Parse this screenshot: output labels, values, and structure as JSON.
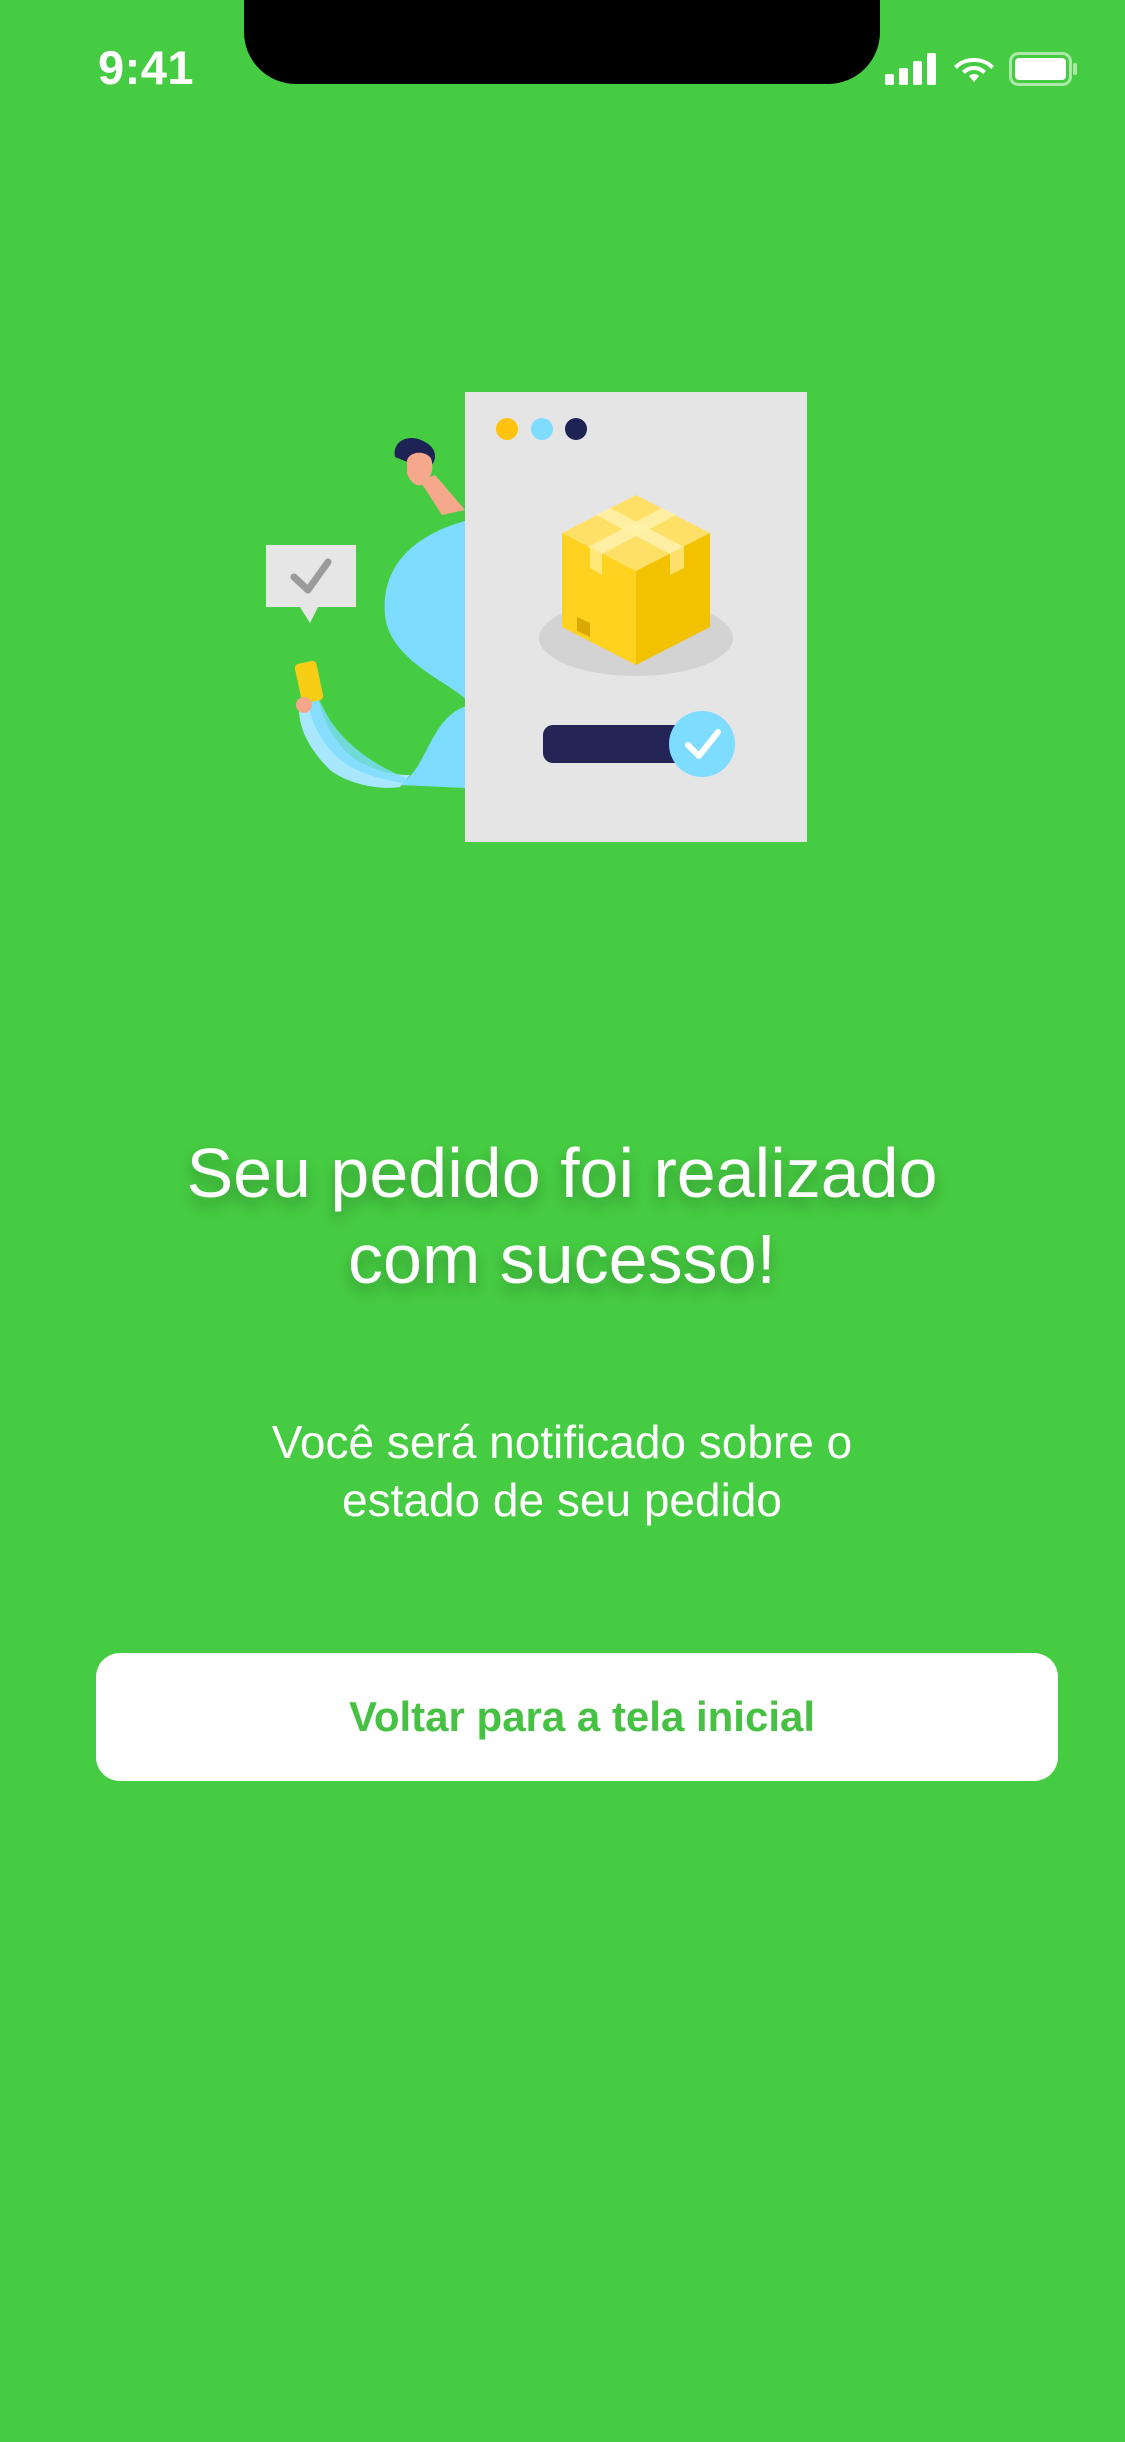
{
  "status_bar": {
    "time": "9:41",
    "icons": [
      "cellular-signal-icon",
      "wifi-icon",
      "battery-icon"
    ]
  },
  "illustration": {
    "name": "order-success-illustration",
    "elements": [
      "person-icon",
      "chat-bubble-check-icon",
      "package-box-icon",
      "checkmark-icon"
    ]
  },
  "content": {
    "title": "Seu pedido foi realizado\ncom sucesso!",
    "subtitle": "Você será notificado sobre o\nestado de seu pedido"
  },
  "actions": {
    "home_button_label": "Voltar para a tela inicial"
  },
  "colors": {
    "background": "#46CC42",
    "button_background": "#FFFFFF",
    "button_text": "#46C143",
    "text": "#FFFFFF",
    "box_yellow": "#FFD21F",
    "person_light_blue": "#7DDCFF",
    "progress_bar_navy": "#242556"
  }
}
